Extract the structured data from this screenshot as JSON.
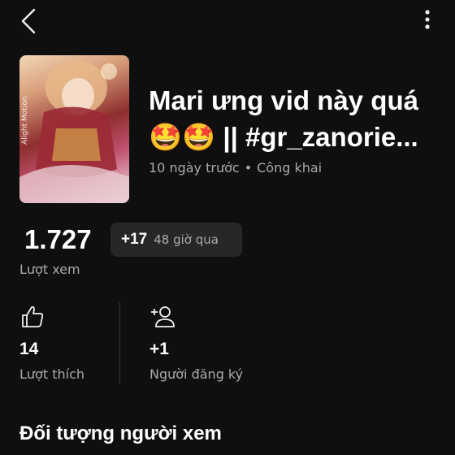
{
  "header": {
    "back_icon": "chevron-left-icon",
    "more_icon": "more-vertical-icon"
  },
  "video": {
    "title": "Mari ưng vid này quá 🤩🤩 || #gr_zanorie...",
    "age": "10 ngày trước",
    "separator": "•",
    "visibility": "Công khai",
    "thumbnail_watermark": "Alight Motion"
  },
  "views": {
    "count": "1.727",
    "label": "Lượt xem",
    "delta": "+17",
    "delta_period": "48 giờ qua"
  },
  "stats": {
    "likes": {
      "icon": "thumbs-up-icon",
      "value": "14",
      "label": "Lượt thích"
    },
    "subscribers": {
      "icon": "add-person-icon",
      "value": "+1",
      "label": "Người đăng ký"
    }
  },
  "section": {
    "title": "Đối tượng người xem"
  },
  "colors": {
    "background": "#0f0f0f",
    "chip": "#272727",
    "primary_text": "#ffffff",
    "secondary_text": "#aaaaaa"
  }
}
